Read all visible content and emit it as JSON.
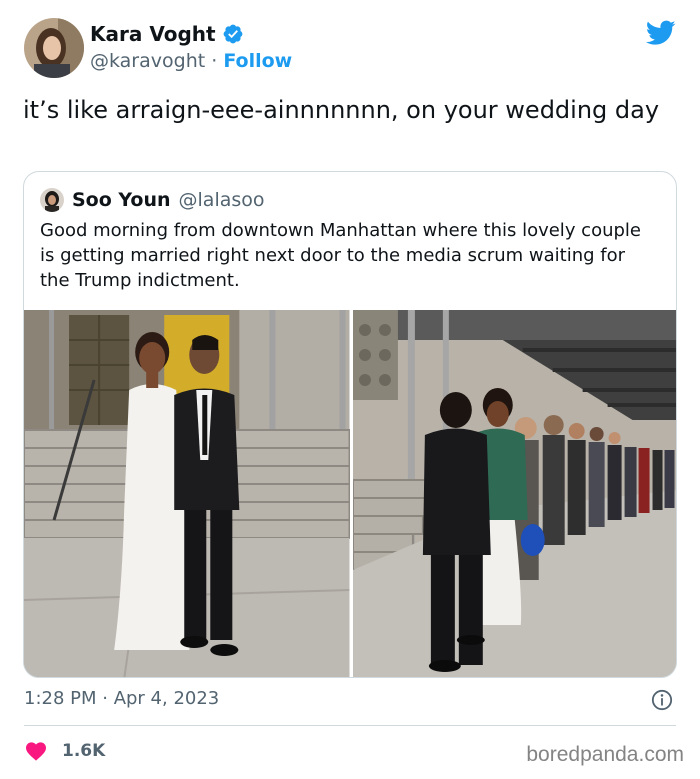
{
  "tweet": {
    "author_name": "Kara Voght",
    "author_handle": "@karavoght",
    "separator": "·",
    "follow_label": "Follow",
    "text": "it’s like arraign-eee-ainnnnnnn, on your wedding day",
    "timestamp": "1:28 PM · Apr 4, 2023",
    "like_count": "1.6K"
  },
  "quote": {
    "author_name": "Soo Youn",
    "author_handle": "@lalasoo",
    "text": "Good morning from downtown Manhattan where this lovely couple is getting married right next door to the media scrum waiting for the Trump indictment."
  },
  "colors": {
    "accent": "#1d9bf0",
    "like": "#f91880",
    "muted_text": "#536471"
  },
  "icons": [
    "verified-badge-icon",
    "twitter-bird-icon",
    "info-icon",
    "heart-icon"
  ],
  "watermark": "boredpanda.com"
}
